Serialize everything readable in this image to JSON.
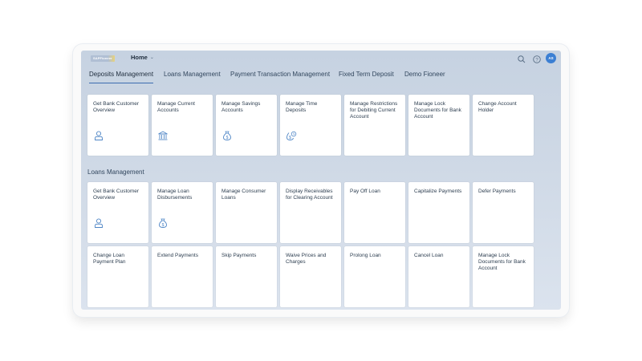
{
  "shell": {
    "logo_text": "SAPFioneer",
    "home_label": "Home",
    "avatar_initials": "AS"
  },
  "tabs": [
    {
      "label": "Deposits Management",
      "active": true
    },
    {
      "label": "Loans Management",
      "active": false
    },
    {
      "label": "Payment Transaction Management",
      "active": false
    },
    {
      "label": "Fixed Term Deposit",
      "active": false
    },
    {
      "label": "Demo Fioneer",
      "active": false
    }
  ],
  "deposits_tiles": [
    {
      "title": "Get Bank Customer Overview",
      "icon": "person-icon"
    },
    {
      "title": "Manage Current Accounts",
      "icon": "bank-icon"
    },
    {
      "title": "Manage Savings Accounts",
      "icon": "money-bag-icon"
    },
    {
      "title": "Manage Time Deposits",
      "icon": "money-bag-clock-icon"
    },
    {
      "title": "Manage Restrictions for Debiting Current Account",
      "icon": ""
    },
    {
      "title": "Manage Lock Documents for Bank Account",
      "icon": ""
    },
    {
      "title": "Change Account Holder",
      "icon": ""
    }
  ],
  "loans_section_title": "Loans Management",
  "loans_tiles_row1": [
    {
      "title": "Get Bank Customer Overview",
      "icon": "person-icon"
    },
    {
      "title": "Manage Loan Disbursements",
      "icon": "money-bag-icon"
    },
    {
      "title": "Manage Consumer Loans",
      "icon": ""
    },
    {
      "title": "Display Receivables for Clearing Account",
      "icon": ""
    },
    {
      "title": "Pay Off Loan",
      "icon": ""
    },
    {
      "title": "Capitalize Payments",
      "icon": ""
    },
    {
      "title": "Defer Payments",
      "icon": ""
    }
  ],
  "loans_tiles_row2": [
    {
      "title": "Change Loan Payment Plan",
      "icon": ""
    },
    {
      "title": "Extend Payments",
      "icon": ""
    },
    {
      "title": "Skip Payments",
      "icon": ""
    },
    {
      "title": "Waive Prices and Charges",
      "icon": ""
    },
    {
      "title": "Prolong Loan",
      "icon": ""
    },
    {
      "title": "Cancel Loan",
      "icon": ""
    },
    {
      "title": "Manage Lock Documents for Bank Account",
      "icon": ""
    }
  ],
  "colors": {
    "accent": "#3c6cb0",
    "icon": "#4f86c6",
    "avatar": "#3b7fd3"
  }
}
